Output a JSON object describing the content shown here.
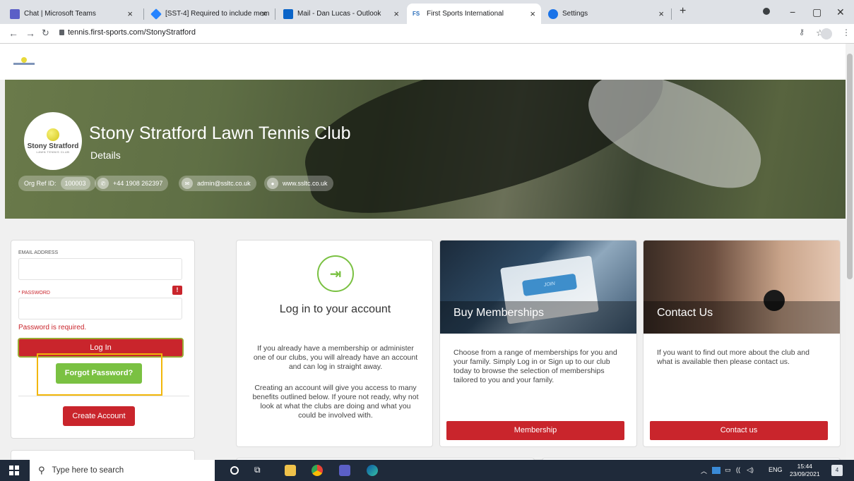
{
  "browser": {
    "tabs": [
      {
        "title": "Chat | Microsoft Teams",
        "icon": "teams-icon",
        "color": "#5b5fc7"
      },
      {
        "title": "[SST-4] Required to include mem",
        "icon": "jira-icon",
        "color": "#2684ff"
      },
      {
        "title": "Mail - Dan Lucas - Outlook",
        "icon": "outlook-icon",
        "color": "#0a64c8"
      },
      {
        "title": "First Sports International",
        "icon": "fs-icon",
        "color": "#2a6ebb"
      },
      {
        "title": "Settings",
        "icon": "settings-icon",
        "color": "#1a73e8"
      }
    ],
    "new_tab": "+",
    "url": "tennis.first-sports.com/StonyStratford"
  },
  "club": {
    "logo_line1": "Stony Stratford",
    "logo_line2": "LAWN TENNIS CLUB",
    "name": "Stony Stratford Lawn Tennis Club",
    "subtitle": "Details",
    "org_ref_label": "Org Ref ID:",
    "org_ref_value": "100003",
    "phone": "+44 1908 262397",
    "email": "admin@ssltc.co.uk",
    "website": "www.ssltc.co.uk"
  },
  "login": {
    "email_label": "EMAIL ADDRESS",
    "email_value": "",
    "password_label": "* PASSWORD",
    "password_value": "",
    "error_badge": "!",
    "error_message": "Password is required.",
    "login_button": "Log In",
    "forgot_button": "Forgot Password?",
    "create_button": "Create Account"
  },
  "info": {
    "title": "Log in to your account",
    "para1": "If you already have a membership or administer one of our clubs, you will already have an account and can log in straight away.",
    "para2": "Creating an account will give you access to many benefits outlined below. If youre not ready, why not look at what the clubs are doing and what you could be involved with."
  },
  "memberships": {
    "title": "Buy Memberships",
    "join_text": "JOIN",
    "description": "Choose from a range of memberships for you and your family. Simply Log in or Sign up to our club today to browse the selection of memberships tailored to you and your family.",
    "button": "Membership"
  },
  "contact": {
    "title": "Contact Us",
    "description": "If you want to find out more about the club and what is available then please contact us.",
    "button": "Contact us"
  },
  "taskbar": {
    "search_placeholder": "Type here to search",
    "lang": "ENG",
    "time": "15:44",
    "date": "23/09/2021",
    "notifications": "4"
  },
  "colors": {
    "accent_red": "#c9252c",
    "accent_green": "#7ac142",
    "highlight": "#f2b70a"
  }
}
